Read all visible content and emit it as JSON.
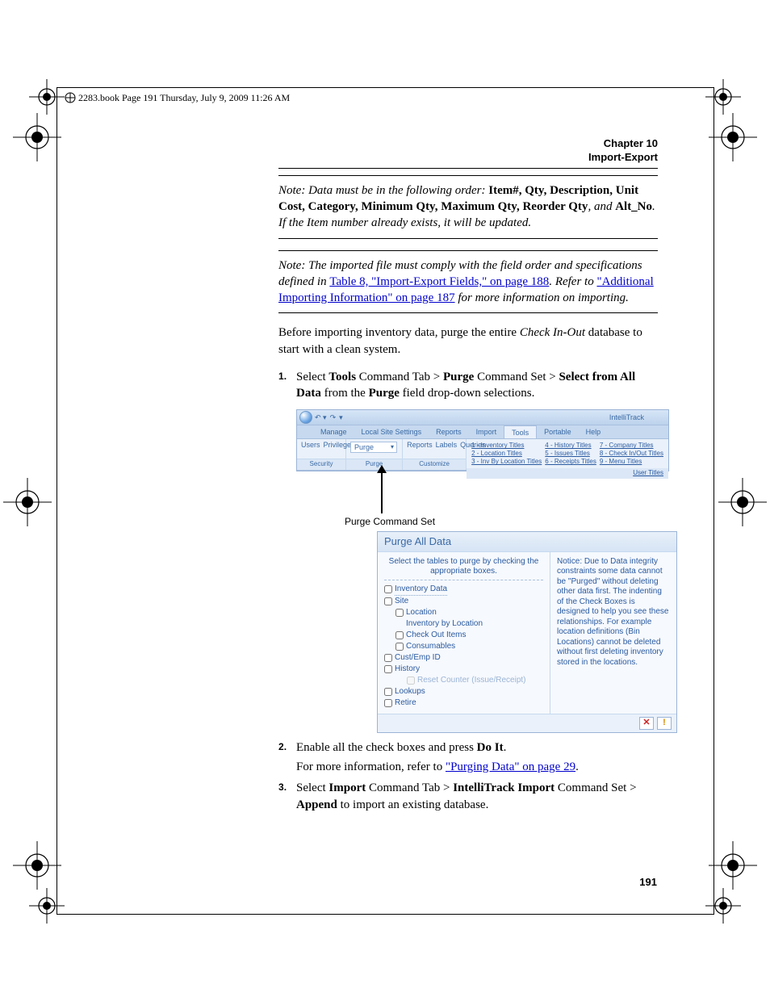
{
  "running_head": "2283.book  Page 191  Thursday, July 9, 2009  11:26 AM",
  "chapter": {
    "line1": "Chapter 10",
    "line2": "Import-Export"
  },
  "note1": {
    "prefix": "Note:   Data must be in the following order: ",
    "fields": "Item#, Qty, Description, Unit Cost, Category, Minimum Qty, Maximum Qty, Reorder Qty",
    "tail": ", and ",
    "altno": "Alt_No",
    "suffix": ". If the Item number already exists, it will be updated."
  },
  "note2": {
    "prefix": "Note:   The imported file must comply with the field order and specifications defined in ",
    "link1": "Table 8, \"Import-Export Fields,\" on page 188",
    "mid1": ". Refer to ",
    "link2": "\"Additional Importing Information\" on page 187",
    "mid2": " for more information on importing."
  },
  "para": "Before importing inventory data, purge the entire Check In-Out database to start with a clean system.",
  "para_italic": "Check In-Out",
  "step1": {
    "a": "Select ",
    "b": "Tools",
    "c": " Command Tab > ",
    "d": "Purge",
    "e": " Command Set > ",
    "f": "Select from All Data",
    "g": " from the ",
    "h": "Purge",
    "i": " field drop-down selections."
  },
  "step2": {
    "a": "Enable all the check boxes and press ",
    "b": "Do It",
    "c": ".",
    "d": "For more information, refer to ",
    "link": "\"Purging Data\" on page 29",
    "e": "."
  },
  "step3": {
    "a": "Select ",
    "b": "Import",
    "c": " Command Tab > ",
    "d": "IntelliTrack Import",
    "e": " Command Set > ",
    "f": "Append",
    "g": " to import an existing database."
  },
  "arrow_label": "Purge Command Set",
  "page_number": "191",
  "ribbon": {
    "app": "IntelliTrack",
    "tabs": [
      "Manage",
      "Local Site Settings",
      "Reports",
      "Import",
      "Tools",
      "Portable",
      "Help"
    ],
    "active_tab": "Tools",
    "group_security": {
      "users": "Users",
      "priv": "Privileges",
      "label": "Security"
    },
    "group_purge": {
      "combo": "Purge",
      "label": "Purge"
    },
    "group_custom": {
      "reports": "Reports",
      "labels": "Labels",
      "queries": "Queries",
      "label": "Customize"
    },
    "links": [
      "1 - Inventory Titles",
      "2 - Location Titles",
      "3 - Inv By Location Titles",
      "4 - History Titles",
      "5 - Issues Titles",
      "6 - Receipts Titles",
      "7 - Company Titles",
      "8 - Check In/Out Titles",
      "9 - Menu Titles"
    ],
    "footer": "User Titles"
  },
  "dialog": {
    "title": "Purge All Data",
    "instr": "Select the tables to purge by checking the appropriate boxes.",
    "items": {
      "inventory": "Inventory Data",
      "site": "Site",
      "location": "Location",
      "invbyloc": "Inventory by Location",
      "checkout": "Check Out Items",
      "consumables": "Consumables",
      "cust": "Cust/Emp ID",
      "history": "History",
      "reset": "Reset Counter (Issue/Receipt)",
      "lookups": "Lookups",
      "retire": "Retire"
    },
    "notice": "Notice: Due to Data integrity constraints some data cannot be \"Purged\" without deleting other data first. The indenting of the Check Boxes is designed to help you see these relationships. For example location definitions (Bin Locations) cannot be deleted without first deleting inventory stored in the  locations.",
    "close": "✕",
    "doit": "!"
  }
}
